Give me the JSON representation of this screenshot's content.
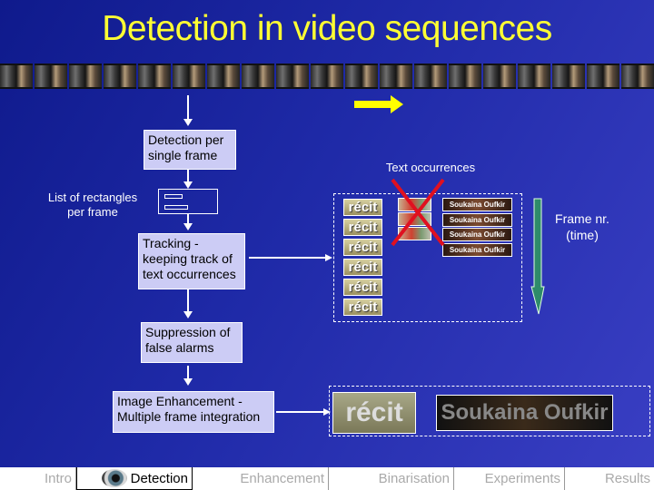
{
  "slide": {
    "title": "Detection in video sequences",
    "accent_color": "#ffff33",
    "background_color": "#1f2aa8",
    "filmstrip_frame_count": 20
  },
  "flow": {
    "detection_box": "Detection per single frame",
    "rectangles_label": "List of rectangles per frame",
    "tracking_box": "Tracking - keeping track of text occurrences",
    "suppression_box": "Suppression of false alarms",
    "enhancement_box": "Image Enhancement - Multiple frame integration"
  },
  "occurrences": {
    "label": "Text occurrences",
    "time_label": "Frame nr. (time)",
    "recit_text": "récit",
    "recit_count": 6,
    "false_alarm_count": 3,
    "name_text": "Soukaina Oufkir",
    "name_count": 4,
    "rejected_mark_color": "#e01020",
    "time_arrow_color": "#2e8b6a"
  },
  "result": {
    "recit_text": "récit",
    "name_text": "Soukaina Oufkir"
  },
  "navbar": {
    "items": [
      {
        "label": "Intro",
        "active": false
      },
      {
        "label": "Detection",
        "active": true,
        "icon": "eye-icon"
      },
      {
        "label": "Enhancement",
        "active": false
      },
      {
        "label": "Binarisation",
        "active": false
      },
      {
        "label": "Experiments",
        "active": false
      },
      {
        "label": "Results",
        "active": false
      }
    ]
  }
}
